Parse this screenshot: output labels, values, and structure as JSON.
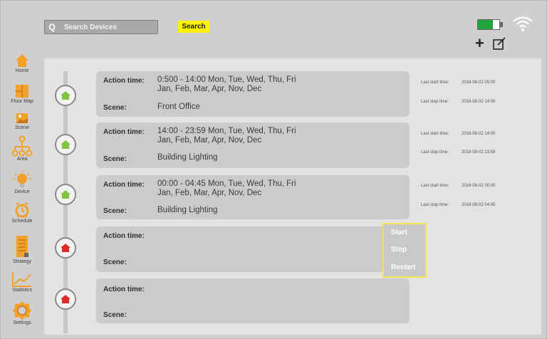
{
  "search": {
    "placeholder": "Search Devices",
    "button_label": "Search",
    "icon": "Q"
  },
  "toolbar": {
    "add_symbol": "+",
    "colors": {
      "search_button": "#fff400",
      "battery": "#1fa53a",
      "nav_icon": "#f2a12a"
    }
  },
  "sidebar": {
    "items": [
      {
        "label": "Home",
        "icon": "home-icon"
      },
      {
        "label": "Floor Map",
        "icon": "floor-map-icon"
      },
      {
        "label": "Scene",
        "icon": "scene-icon"
      },
      {
        "label": "Area",
        "icon": "area-icon"
      },
      {
        "label": "Device",
        "icon": "device-icon"
      },
      {
        "label": "Schedule",
        "icon": "schedule-icon"
      },
      {
        "label": "Strategy",
        "icon": "strategy-icon"
      },
      {
        "label": "Statistics",
        "icon": "statistics-icon"
      },
      {
        "label": "Settings",
        "icon": "settings-icon"
      }
    ]
  },
  "schedules": [
    {
      "status": "active",
      "action_label": "Action time:",
      "scene_label": "Scene:",
      "time_line1": "0:500 - 14:00  Mon, Tue, Wed, Thu, Fri",
      "time_line2": "Jan, Feb, Mar, Apr, Nov, Dec",
      "scene": "Front Office",
      "last_start_label": "Last start time:",
      "last_start": "2018-08-02 05:00",
      "last_stop_label": "Last stop time:",
      "last_stop": "2018-08-02 14:00"
    },
    {
      "status": "active",
      "action_label": "Action time:",
      "scene_label": "Scene:",
      "time_line1": "14:00 - 23:59  Mon, Tue, Wed, Thu, Fri",
      "time_line2": "Jan, Feb, Mar, Apr, Nov, Dec",
      "scene": "Building Lighting",
      "last_start_label": "Last start time:",
      "last_start": "2018-08-02 14:00",
      "last_stop_label": "Last stop time:",
      "last_stop": "2018-08-02 23:59"
    },
    {
      "status": "active",
      "action_label": "Action time:",
      "scene_label": "Scene:",
      "time_line1": "00:00 - 04:45  Mon, Tue, Wed, Thu, Fri",
      "time_line2": "Jan, Feb, Mar, Apr, Nov, Dec",
      "scene": "Building Lighting",
      "last_start_label": "Last start time:",
      "last_start": "2018-08-02 00:00",
      "last_stop_label": "Last stop time:",
      "last_stop": "2018-08-02 04:45"
    },
    {
      "status": "inactive",
      "action_label": "Action time:",
      "scene_label": "Scene:"
    },
    {
      "status": "inactive",
      "action_label": "Action time:",
      "scene_label": "Scene:"
    }
  ],
  "context_menu": {
    "items": [
      "Start",
      "Stop",
      "Restart"
    ]
  }
}
